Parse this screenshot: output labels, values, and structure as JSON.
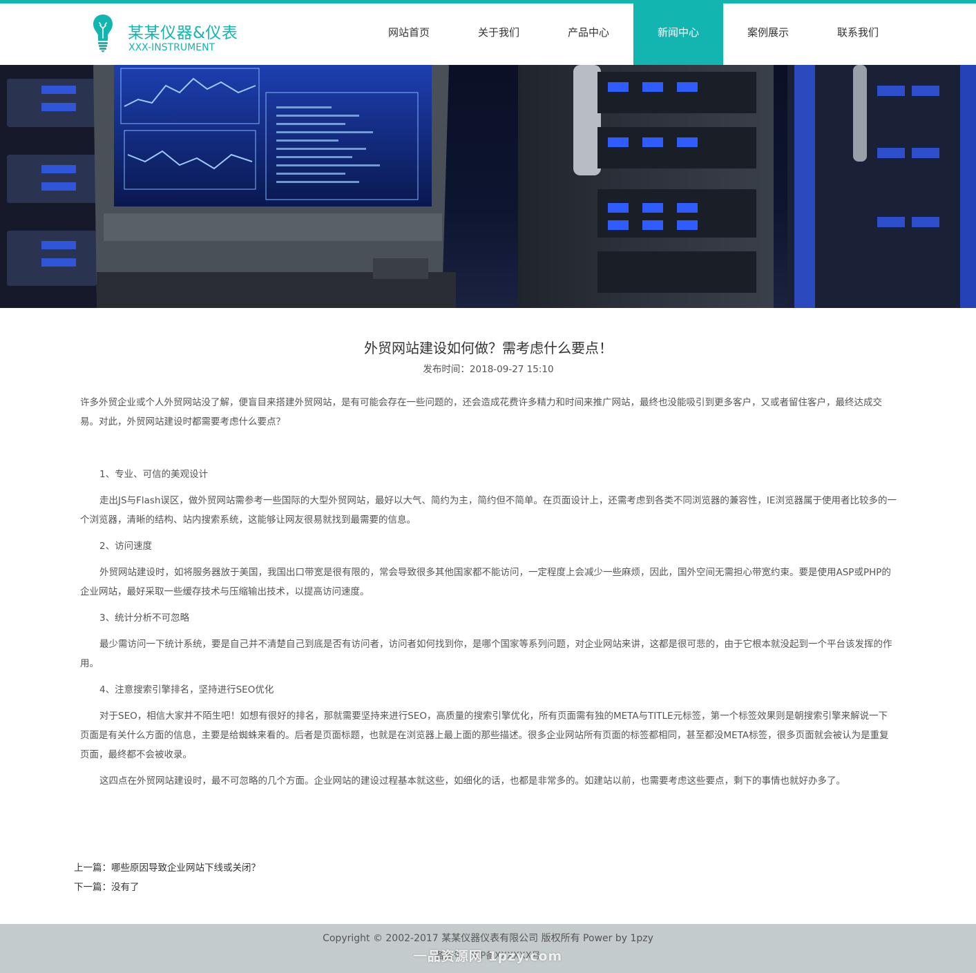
{
  "colors": {
    "accent": "#13b5b1",
    "footer_bg": "#c3cbcc"
  },
  "header": {
    "logo_cn": "某某仪器&仪表",
    "logo_en": "XXX-INSTRUMENT",
    "logo_icon": "lightbulb-icon"
  },
  "nav": {
    "items": [
      {
        "label": "网站首页"
      },
      {
        "label": "关于我们"
      },
      {
        "label": "产品中心"
      },
      {
        "label": "新闻中心",
        "active": true
      },
      {
        "label": "案例展示"
      },
      {
        "label": "联系我们"
      }
    ]
  },
  "banner": {
    "image": "server-room-laptop-photo"
  },
  "article": {
    "title": "外贸网站建设如何做？需考虑什么要点！",
    "date": "发布时间：2018-09-27 15:10",
    "paragraphs": [
      "许多外贸企业或个人外贸网站没了解，便盲目来搭建外贸网站，是有可能会存在一些问题的，还会造成花费许多精力和时间来推广网站，最终也没能吸引到更多客户，又或者留住客户，最终达成交易。对此，外贸网站建设时都需要考虑什么要点？",
      "1、专业、可信的美观设计",
      "走出JS与Flash误区，做外贸网站需参考一些国际的大型外贸网站，最好以大气、简约为主，简约但不简单。在页面设计上，还需考虑到各类不同浏览器的兼容性，IE浏览器属于使用者比较多的一个浏览器，清晰的结构、站内搜索系统，这能够让网友很易就找到最需要的信息。",
      "2、访问速度",
      "外贸网站建设时，如将服务器放于美国，我国出口带宽是很有限的，常会导致很多其他国家都不能访问，一定程度上会减少一些麻烦，因此，国外空间无需担心带宽约束。要是使用ASP或PHP的企业网站，最好采取一些缓存技术与压缩输出技术，以提高访问速度。",
      "3、统计分析不可忽略",
      "最少需访问一下统计系统，要是自己并不清楚自己到底是否有访问者，访问者如何找到你，是哪个国家等系列问题，对企业网站来讲，这都是很可悲的，由于它根本就没起到一个平台该发挥的作用。",
      "4、注意搜索引擎排名，坚持进行SEO优化",
      "对于SEO，相信大家并不陌生吧！如想有很好的排名，那就需要坚持来进行SEO，高质量的搜索引擎优化，所有页面需有独的META与TITLE元标签，第一个标签效果则是朝搜索引擎来解说一下页面是有关什么方面的信息，主要是给蜘蛛来看的。后者是页面标题，也就是在浏览器上最上面的那些描述。很多企业网站所有页面的标签都相同，甚至都没META标签，很多页面就会被认为是重复页面，最终都不会被收录。",
      "这四点在外贸网站建设时，最不可忽略的几个方面。企业网站的建设过程基本就这些，如细化的话，也都是非常多的。如建站以前，也需要考虑这些要点，剩下的事情也就好办多了。"
    ],
    "prev": "上一篇：哪些原因导致企业网站下线或关闭？",
    "next": "下一篇：没有了"
  },
  "footer": {
    "copyright": "Copyright © 2002-2017 某某仪器仪表有限公司 版权所有 Power by 1pzy",
    "icp": "备案号：ICP备XXXXXX号",
    "watermark": "一品资源网 1pzy.com"
  }
}
